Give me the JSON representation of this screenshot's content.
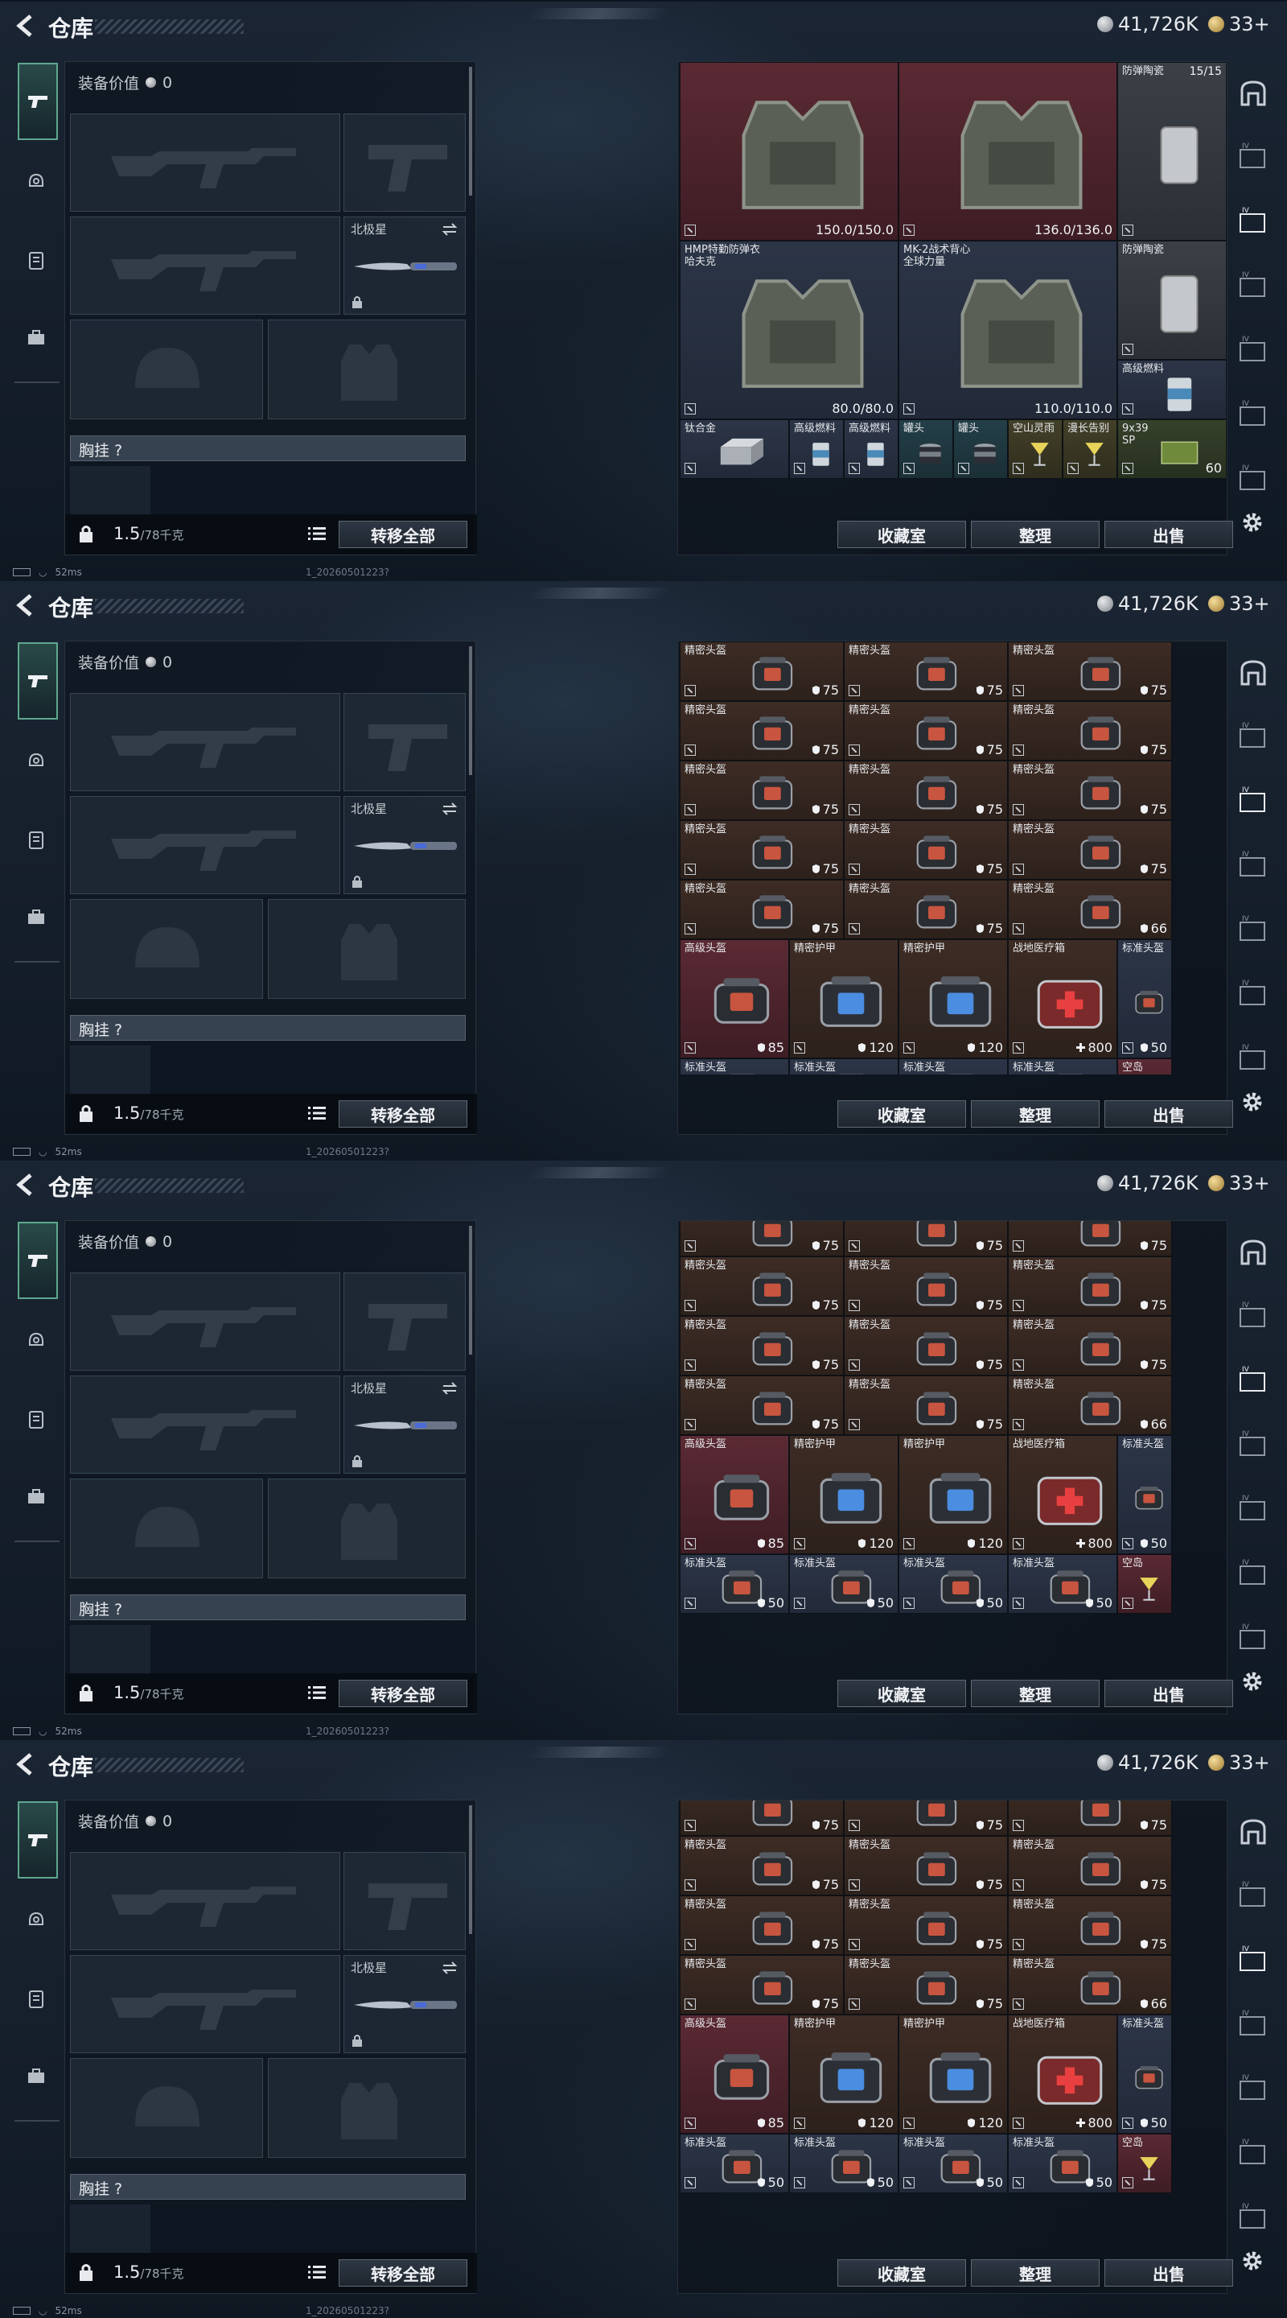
{
  "header": {
    "title": "仓库",
    "silver": "41,726K",
    "gold": "33+"
  },
  "loadout": {
    "equip_value_label": "装备价值",
    "equip_value": "0",
    "secondary_slot_label": "北极星",
    "chest_label": "胸挂 ?",
    "weight": "1.5",
    "weight_cap": "/78千克",
    "transfer_all": "转移全部"
  },
  "storage_buttons": {
    "collection": "收藏室",
    "sort": "整理",
    "sell": "出售"
  },
  "status_bar": {
    "ping": "52ms",
    "build": "1_20260501223?"
  },
  "colors": {
    "accent": "#5fa88f",
    "brown_cell": "#3d2c25",
    "red_cell": "#5b2a34",
    "blue_cell": "#2c3547"
  },
  "panels": [
    {
      "cells": [
        {
          "name": "",
          "value": "150.0/150.0",
          "icon": "body-armor-icon",
          "color": "red",
          "col": 0,
          "row": 0,
          "w": 2,
          "h": 3
        },
        {
          "name": "",
          "value": "136.0/136.0",
          "icon": "body-armor-icon",
          "color": "red",
          "col": 2,
          "row": 0,
          "w": 2,
          "h": 3
        },
        {
          "name": "防弹陶瓷",
          "value": "15/15",
          "icon": "ceramic-plate-icon",
          "color": "gray",
          "col": 4,
          "row": 0,
          "w": 1,
          "h": 3
        },
        {
          "name": "HMP特勤防弹衣\n哈夫克",
          "value": "80.0/80.0",
          "icon": "body-armor-icon",
          "color": "blue",
          "col": 0,
          "row": 3,
          "w": 2,
          "h": 3
        },
        {
          "name": "MK-2战术背心\n全球力量",
          "value": "110.0/110.0",
          "icon": "body-armor-icon",
          "color": "blue",
          "col": 2,
          "row": 3,
          "w": 2,
          "h": 3
        },
        {
          "name": "防弹陶瓷",
          "value": "",
          "icon": "ceramic-plate-icon",
          "color": "gray",
          "col": 4,
          "row": 3,
          "w": 1,
          "h": 2
        },
        {
          "name": "高级燃料",
          "value": "",
          "icon": "fuel-can-icon",
          "color": "blue",
          "col": 4,
          "row": 5,
          "w": 1,
          "h": 1
        },
        {
          "name": "钛合金",
          "value": "",
          "icon": "titanium-ingot-icon",
          "color": "blue",
          "col": 0,
          "row": 6,
          "w": 1,
          "h": 1
        },
        {
          "name": "高级燃料",
          "value": "",
          "icon": "fuel-can-icon",
          "color": "blue",
          "col": 1,
          "row": 6,
          "w": 0.5,
          "h": 1
        },
        {
          "name": "高级燃料",
          "value": "",
          "icon": "fuel-can-icon",
          "color": "blue",
          "col": 1.5,
          "row": 6,
          "w": 0.5,
          "h": 1
        },
        {
          "name": "罐头",
          "value": "",
          "icon": "canned-food-icon",
          "color": "teal",
          "col": 2,
          "row": 6,
          "w": 0.5,
          "h": 1
        },
        {
          "name": "罐头",
          "value": "",
          "icon": "canned-food-icon",
          "color": "teal",
          "col": 2.5,
          "row": 6,
          "w": 0.5,
          "h": 1
        },
        {
          "name": "空山灵雨",
          "value": "",
          "icon": "cocktail-icon",
          "color": "olive",
          "col": 3,
          "row": 6,
          "w": 0.5,
          "h": 1
        },
        {
          "name": "漫长告别",
          "value": "",
          "icon": "cocktail-icon",
          "color": "olive",
          "col": 3.5,
          "row": 6,
          "w": 0.5,
          "h": 1
        },
        {
          "name": "9x39\nSP",
          "value": "60",
          "icon": "ammo-box-icon",
          "color": "green",
          "col": 4,
          "row": 6,
          "w": 1,
          "h": 1
        }
      ]
    },
    {
      "cells": [
        {
          "name": "精密头盔",
          "value": "75",
          "icon": "helmet-icon",
          "color": "brown",
          "col": 0,
          "row": 0,
          "w": 1.5,
          "h": 1
        },
        {
          "name": "精密头盔",
          "value": "75",
          "icon": "helmet-icon",
          "color": "brown",
          "col": 1.5,
          "row": 0,
          "w": 1.5,
          "h": 1
        },
        {
          "name": "精密头盔",
          "value": "75",
          "icon": "helmet-icon",
          "color": "brown",
          "col": 3,
          "row": 0,
          "w": 1.5,
          "h": 1
        },
        {
          "name": "精密头盔",
          "value": "75",
          "icon": "helmet-icon",
          "color": "brown",
          "col": 0,
          "row": 1,
          "w": 1.5,
          "h": 1
        },
        {
          "name": "精密头盔",
          "value": "75",
          "icon": "helmet-icon",
          "color": "brown",
          "col": 1.5,
          "row": 1,
          "w": 1.5,
          "h": 1
        },
        {
          "name": "精密头盔",
          "value": "75",
          "icon": "helmet-icon",
          "color": "brown",
          "col": 3,
          "row": 1,
          "w": 1.5,
          "h": 1
        },
        {
          "name": "精密头盔",
          "value": "75",
          "icon": "helmet-icon",
          "color": "brown",
          "col": 0,
          "row": 2,
          "w": 1.5,
          "h": 1
        },
        {
          "name": "精密头盔",
          "value": "75",
          "icon": "helmet-icon",
          "color": "brown",
          "col": 1.5,
          "row": 2,
          "w": 1.5,
          "h": 1
        },
        {
          "name": "精密头盔",
          "value": "75",
          "icon": "helmet-icon",
          "color": "brown",
          "col": 3,
          "row": 2,
          "w": 1.5,
          "h": 1
        },
        {
          "name": "精密头盔",
          "value": "75",
          "icon": "helmet-icon",
          "color": "brown",
          "col": 0,
          "row": 3,
          "w": 1.5,
          "h": 1
        },
        {
          "name": "精密头盔",
          "value": "75",
          "icon": "helmet-icon",
          "color": "brown",
          "col": 1.5,
          "row": 3,
          "w": 1.5,
          "h": 1
        },
        {
          "name": "精密头盔",
          "value": "75",
          "icon": "helmet-icon",
          "color": "brown",
          "col": 3,
          "row": 3,
          "w": 1.5,
          "h": 1
        },
        {
          "name": "精密头盔",
          "value": "75",
          "icon": "helmet-icon",
          "color": "brown",
          "col": 0,
          "row": 4,
          "w": 1.5,
          "h": 1
        },
        {
          "name": "精密头盔",
          "value": "75",
          "icon": "helmet-icon",
          "color": "brown",
          "col": 1.5,
          "row": 4,
          "w": 1.5,
          "h": 1
        },
        {
          "name": "精密头盔",
          "value": "66",
          "icon": "helmet-icon",
          "color": "brown",
          "col": 3,
          "row": 4,
          "w": 1.5,
          "h": 1
        },
        {
          "name": "高级头盔",
          "value": "85",
          "icon": "helmet-icon",
          "color": "red",
          "col": 0,
          "row": 5,
          "w": 1,
          "h": 2
        },
        {
          "name": "精密护甲",
          "value": "120",
          "icon": "armor-case-icon",
          "color": "brown",
          "col": 1,
          "row": 5,
          "w": 1,
          "h": 2
        },
        {
          "name": "精密护甲",
          "value": "120",
          "icon": "armor-case-icon",
          "color": "brown",
          "col": 2,
          "row": 5,
          "w": 1,
          "h": 2
        },
        {
          "name": "战地医疗箱",
          "value": "800",
          "icon": "medkit-icon",
          "color": "brown",
          "col": 3,
          "row": 5,
          "w": 1,
          "h": 2
        },
        {
          "name": "标准头盔",
          "value": "50",
          "icon": "helmet-icon",
          "color": "blue",
          "col": 4,
          "row": 5,
          "w": 0.5,
          "h": 2
        },
        {
          "name": "标准头盔",
          "value": "",
          "icon": "helmet-icon",
          "color": "blue",
          "col": 0,
          "row": 7,
          "w": 1,
          "h": 1
        },
        {
          "name": "标准头盔",
          "value": "",
          "icon": "helmet-icon",
          "color": "blue",
          "col": 1,
          "row": 7,
          "w": 1,
          "h": 1
        },
        {
          "name": "标准头盔",
          "value": "",
          "icon": "helmet-icon",
          "color": "blue",
          "col": 2,
          "row": 7,
          "w": 1,
          "h": 1
        },
        {
          "name": "标准头盔",
          "value": "",
          "icon": "helmet-icon",
          "color": "blue",
          "col": 3,
          "row": 7,
          "w": 1,
          "h": 1
        },
        {
          "name": "空岛",
          "value": "",
          "icon": "cocktail-icon",
          "color": "red",
          "col": 4,
          "row": 7,
          "w": 0.5,
          "h": 1
        }
      ]
    },
    {
      "cells": [
        {
          "name": "",
          "value": "75",
          "icon": "helmet-icon",
          "color": "brown",
          "col": 0,
          "row": -0.4,
          "w": 1.5,
          "h": 1
        },
        {
          "name": "",
          "value": "75",
          "icon": "helmet-icon",
          "color": "brown",
          "col": 1.5,
          "row": -0.4,
          "w": 1.5,
          "h": 1
        },
        {
          "name": "",
          "value": "75",
          "icon": "helmet-icon",
          "color": "brown",
          "col": 3,
          "row": -0.4,
          "w": 1.5,
          "h": 1
        },
        {
          "name": "精密头盔",
          "value": "75",
          "icon": "helmet-icon",
          "color": "brown",
          "col": 0,
          "row": 0.6,
          "w": 1.5,
          "h": 1
        },
        {
          "name": "精密头盔",
          "value": "75",
          "icon": "helmet-icon",
          "color": "brown",
          "col": 1.5,
          "row": 0.6,
          "w": 1.5,
          "h": 1
        },
        {
          "name": "精密头盔",
          "value": "75",
          "icon": "helmet-icon",
          "color": "brown",
          "col": 3,
          "row": 0.6,
          "w": 1.5,
          "h": 1
        },
        {
          "name": "精密头盔",
          "value": "75",
          "icon": "helmet-icon",
          "color": "brown",
          "col": 0,
          "row": 1.6,
          "w": 1.5,
          "h": 1
        },
        {
          "name": "精密头盔",
          "value": "75",
          "icon": "helmet-icon",
          "color": "brown",
          "col": 1.5,
          "row": 1.6,
          "w": 1.5,
          "h": 1
        },
        {
          "name": "精密头盔",
          "value": "75",
          "icon": "helmet-icon",
          "color": "brown",
          "col": 3,
          "row": 1.6,
          "w": 1.5,
          "h": 1
        },
        {
          "name": "精密头盔",
          "value": "75",
          "icon": "helmet-icon",
          "color": "brown",
          "col": 0,
          "row": 2.6,
          "w": 1.5,
          "h": 1
        },
        {
          "name": "精密头盔",
          "value": "75",
          "icon": "helmet-icon",
          "color": "brown",
          "col": 1.5,
          "row": 2.6,
          "w": 1.5,
          "h": 1
        },
        {
          "name": "精密头盔",
          "value": "66",
          "icon": "helmet-icon",
          "color": "brown",
          "col": 3,
          "row": 2.6,
          "w": 1.5,
          "h": 1
        },
        {
          "name": "高级头盔",
          "value": "85",
          "icon": "helmet-icon",
          "color": "red",
          "col": 0,
          "row": 3.6,
          "w": 1,
          "h": 2
        },
        {
          "name": "精密护甲",
          "value": "120",
          "icon": "armor-case-icon",
          "color": "brown",
          "col": 1,
          "row": 3.6,
          "w": 1,
          "h": 2
        },
        {
          "name": "精密护甲",
          "value": "120",
          "icon": "armor-case-icon",
          "color": "brown",
          "col": 2,
          "row": 3.6,
          "w": 1,
          "h": 2
        },
        {
          "name": "战地医疗箱",
          "value": "800",
          "icon": "medkit-icon",
          "color": "brown",
          "col": 3,
          "row": 3.6,
          "w": 1,
          "h": 2
        },
        {
          "name": "标准头盔",
          "value": "50",
          "icon": "helmet-icon",
          "color": "blue",
          "col": 4,
          "row": 3.6,
          "w": 0.5,
          "h": 2
        },
        {
          "name": "标准头盔",
          "value": "50",
          "icon": "helmet-icon",
          "color": "blue",
          "col": 0,
          "row": 5.6,
          "w": 1,
          "h": 1
        },
        {
          "name": "标准头盔",
          "value": "50",
          "icon": "helmet-icon",
          "color": "blue",
          "col": 1,
          "row": 5.6,
          "w": 1,
          "h": 1
        },
        {
          "name": "标准头盔",
          "value": "50",
          "icon": "helmet-icon",
          "color": "blue",
          "col": 2,
          "row": 5.6,
          "w": 1,
          "h": 1
        },
        {
          "name": "标准头盔",
          "value": "50",
          "icon": "helmet-icon",
          "color": "blue",
          "col": 3,
          "row": 5.6,
          "w": 1,
          "h": 1
        },
        {
          "name": "空岛",
          "value": "",
          "icon": "cocktail-icon",
          "color": "red",
          "col": 4,
          "row": 5.6,
          "w": 0.5,
          "h": 1
        }
      ]
    },
    {
      "cells": [
        {
          "name": "",
          "value": "75",
          "icon": "helmet-icon",
          "color": "brown",
          "col": 0,
          "row": -0.4,
          "w": 1.5,
          "h": 1
        },
        {
          "name": "",
          "value": "75",
          "icon": "helmet-icon",
          "color": "brown",
          "col": 1.5,
          "row": -0.4,
          "w": 1.5,
          "h": 1
        },
        {
          "name": "",
          "value": "75",
          "icon": "helmet-icon",
          "color": "brown",
          "col": 3,
          "row": -0.4,
          "w": 1.5,
          "h": 1
        },
        {
          "name": "精密头盔",
          "value": "75",
          "icon": "helmet-icon",
          "color": "brown",
          "col": 0,
          "row": 0.6,
          "w": 1.5,
          "h": 1
        },
        {
          "name": "精密头盔",
          "value": "75",
          "icon": "helmet-icon",
          "color": "brown",
          "col": 1.5,
          "row": 0.6,
          "w": 1.5,
          "h": 1
        },
        {
          "name": "精密头盔",
          "value": "75",
          "icon": "helmet-icon",
          "color": "brown",
          "col": 3,
          "row": 0.6,
          "w": 1.5,
          "h": 1
        },
        {
          "name": "精密头盔",
          "value": "75",
          "icon": "helmet-icon",
          "color": "brown",
          "col": 0,
          "row": 1.6,
          "w": 1.5,
          "h": 1
        },
        {
          "name": "精密头盔",
          "value": "75",
          "icon": "helmet-icon",
          "color": "brown",
          "col": 1.5,
          "row": 1.6,
          "w": 1.5,
          "h": 1
        },
        {
          "name": "精密头盔",
          "value": "75",
          "icon": "helmet-icon",
          "color": "brown",
          "col": 3,
          "row": 1.6,
          "w": 1.5,
          "h": 1
        },
        {
          "name": "精密头盔",
          "value": "75",
          "icon": "helmet-icon",
          "color": "brown",
          "col": 0,
          "row": 2.6,
          "w": 1.5,
          "h": 1
        },
        {
          "name": "精密头盔",
          "value": "75",
          "icon": "helmet-icon",
          "color": "brown",
          "col": 1.5,
          "row": 2.6,
          "w": 1.5,
          "h": 1
        },
        {
          "name": "精密头盔",
          "value": "66",
          "icon": "helmet-icon",
          "color": "brown",
          "col": 3,
          "row": 2.6,
          "w": 1.5,
          "h": 1
        },
        {
          "name": "高级头盔",
          "value": "85",
          "icon": "helmet-icon",
          "color": "red",
          "col": 0,
          "row": 3.6,
          "w": 1,
          "h": 2
        },
        {
          "name": "精密护甲",
          "value": "120",
          "icon": "armor-case-icon",
          "color": "brown",
          "col": 1,
          "row": 3.6,
          "w": 1,
          "h": 2
        },
        {
          "name": "精密护甲",
          "value": "120",
          "icon": "armor-case-icon",
          "color": "brown",
          "col": 2,
          "row": 3.6,
          "w": 1,
          "h": 2
        },
        {
          "name": "战地医疗箱",
          "value": "800",
          "icon": "medkit-icon",
          "color": "brown",
          "col": 3,
          "row": 3.6,
          "w": 1,
          "h": 2
        },
        {
          "name": "标准头盔",
          "value": "50",
          "icon": "helmet-icon",
          "color": "blue",
          "col": 4,
          "row": 3.6,
          "w": 0.5,
          "h": 2
        },
        {
          "name": "标准头盔",
          "value": "50",
          "icon": "helmet-icon",
          "color": "blue",
          "col": 0,
          "row": 5.6,
          "w": 1,
          "h": 1
        },
        {
          "name": "标准头盔",
          "value": "50",
          "icon": "helmet-icon",
          "color": "blue",
          "col": 1,
          "row": 5.6,
          "w": 1,
          "h": 1
        },
        {
          "name": "标准头盔",
          "value": "50",
          "icon": "helmet-icon",
          "color": "blue",
          "col": 2,
          "row": 5.6,
          "w": 1,
          "h": 1
        },
        {
          "name": "标准头盔",
          "value": "50",
          "icon": "helmet-icon",
          "color": "blue",
          "col": 3,
          "row": 5.6,
          "w": 1,
          "h": 1
        },
        {
          "name": "空岛",
          "value": "",
          "icon": "cocktail-icon",
          "color": "red",
          "col": 4,
          "row": 5.6,
          "w": 0.5,
          "h": 1
        }
      ]
    }
  ]
}
